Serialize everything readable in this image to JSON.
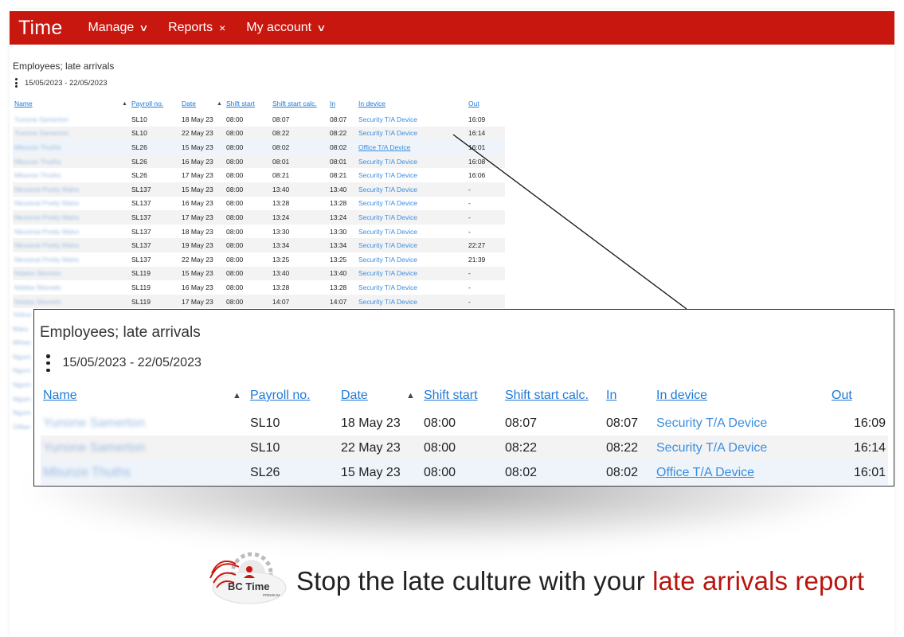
{
  "topbar": {
    "brand": "Time",
    "nav": [
      {
        "label": "Manage",
        "icon": "chevron-down-icon"
      },
      {
        "label": "Reports",
        "icon": "close-icon"
      },
      {
        "label": "My account",
        "icon": "chevron-down-icon"
      }
    ],
    "color": "#c8170f"
  },
  "report": {
    "title": "Employees; late arrivals",
    "range": "15/05/2023 - 22/05/2023",
    "columns": [
      "Name",
      "Payroll no.",
      "Date",
      "Shift start",
      "Shift start calc.",
      "In",
      "In device",
      "Out"
    ],
    "rows": [
      {
        "name": "Yunone Samerton",
        "payroll": "SL10",
        "date": "18 May 23",
        "shift": "08:00",
        "calc": "08:07",
        "in": "08:07",
        "device": "Security T/A Device",
        "out": "16:09"
      },
      {
        "name": "Yunone Samerton",
        "payroll": "SL10",
        "date": "22 May 23",
        "shift": "08:00",
        "calc": "08:22",
        "in": "08:22",
        "device": "Security T/A Device",
        "out": "16:14"
      },
      {
        "name": "Mbunze Thuths",
        "payroll": "SL26",
        "date": "15 May 23",
        "shift": "08:00",
        "calc": "08:02",
        "in": "08:02",
        "device": "Office T/A Device",
        "out": "16:01"
      },
      {
        "name": "Mbunze Thuths",
        "payroll": "SL26",
        "date": "16 May 23",
        "shift": "08:00",
        "calc": "08:01",
        "in": "08:01",
        "device": "Security T/A Device",
        "out": "16:08"
      },
      {
        "name": "Mbunze Thuths",
        "payroll": "SL26",
        "date": "17 May 23",
        "shift": "08:00",
        "calc": "08:21",
        "in": "08:21",
        "device": "Security T/A Device",
        "out": "16:06"
      },
      {
        "name": "Nkosinat Pretty Maho",
        "payroll": "SL137",
        "date": "15 May 23",
        "shift": "08:00",
        "calc": "13:40",
        "in": "13:40",
        "device": "Security T/A Device",
        "out": "-"
      },
      {
        "name": "Nkosinat Pretty Maho",
        "payroll": "SL137",
        "date": "16 May 23",
        "shift": "08:00",
        "calc": "13:28",
        "in": "13:28",
        "device": "Security T/A Device",
        "out": "-"
      },
      {
        "name": "Nkosinat Pretty Maho",
        "payroll": "SL137",
        "date": "17 May 23",
        "shift": "08:00",
        "calc": "13:24",
        "in": "13:24",
        "device": "Security T/A Device",
        "out": "-"
      },
      {
        "name": "Nkosinat Pretty Maho",
        "payroll": "SL137",
        "date": "18 May 23",
        "shift": "08:00",
        "calc": "13:30",
        "in": "13:30",
        "device": "Security T/A Device",
        "out": "-"
      },
      {
        "name": "Nkosinat Pretty Maho",
        "payroll": "SL137",
        "date": "19 May 23",
        "shift": "08:00",
        "calc": "13:34",
        "in": "13:34",
        "device": "Security T/A Device",
        "out": "22:27"
      },
      {
        "name": "Nkosinat Pretty Maho",
        "payroll": "SL137",
        "date": "22 May 23",
        "shift": "08:00",
        "calc": "13:25",
        "in": "13:25",
        "device": "Security T/A Device",
        "out": "21:39"
      },
      {
        "name": "Ndaba Sbonelo",
        "payroll": "SL119",
        "date": "15 May 23",
        "shift": "08:00",
        "calc": "13:40",
        "in": "13:40",
        "device": "Security T/A Device",
        "out": "-"
      },
      {
        "name": "Ndaba Sbonelo",
        "payroll": "SL119",
        "date": "16 May 23",
        "shift": "08:00",
        "calc": "13:28",
        "in": "13:28",
        "device": "Security T/A Device",
        "out": "-"
      },
      {
        "name": "Ndaba Sbonelo",
        "payroll": "SL119",
        "date": "17 May 23",
        "shift": "08:00",
        "calc": "14:07",
        "in": "14:07",
        "device": "Security T/A Device",
        "out": "-"
      }
    ],
    "below_names": [
      "Yelina",
      "Maro",
      "Mhlan",
      "Nguni",
      "Nguni",
      "Ngum",
      "Ngum",
      "Ngum",
      "Olifan"
    ],
    "link_color": "#1f7ad6"
  },
  "zoom": {
    "title": "Employees; late arrivals",
    "range": "15/05/2023 - 22/05/2023",
    "rows_count": 3
  },
  "footer": {
    "logo_text": "BC Time",
    "logo_sub": "PREMIUM",
    "tagline_plain": "Stop the late culture with your ",
    "tagline_red": "late arrivals report",
    "accent": "#b8150e"
  }
}
